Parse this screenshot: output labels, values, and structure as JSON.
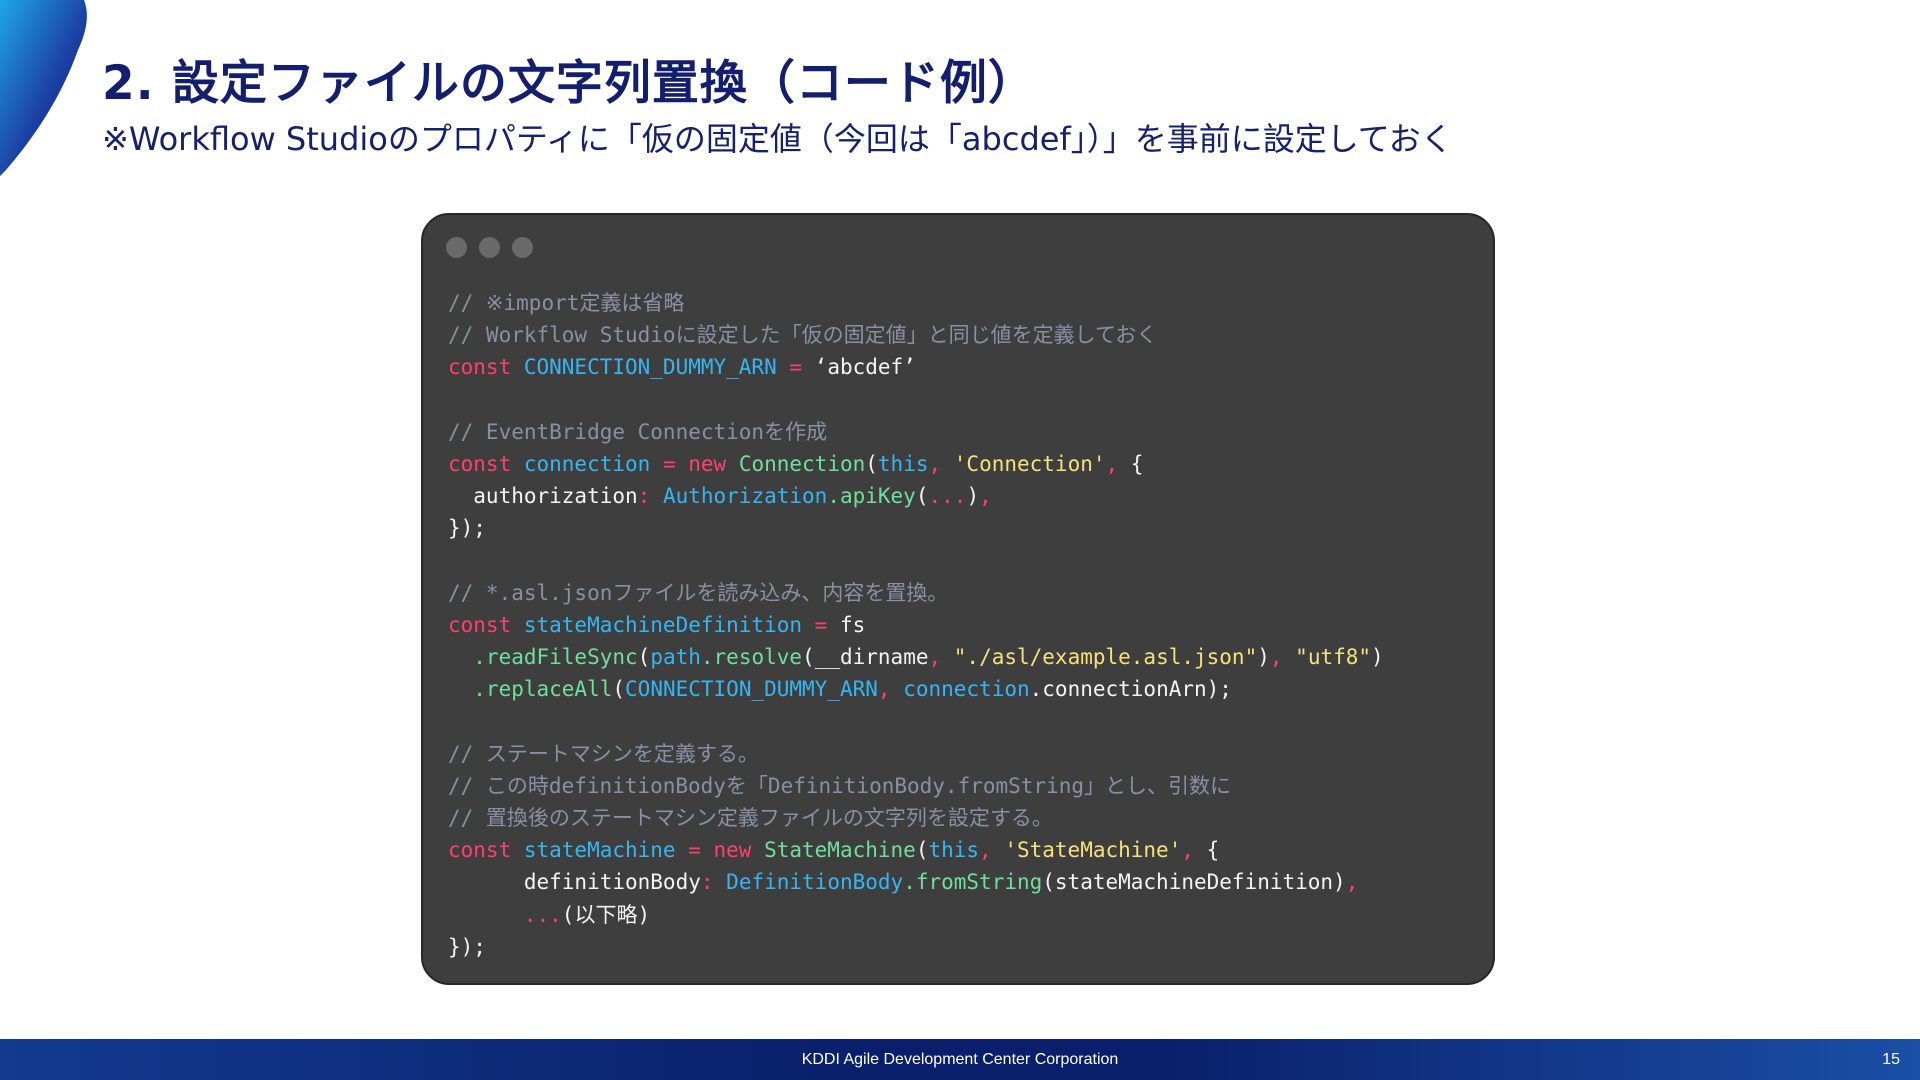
{
  "slide": {
    "title": "2. 設定ファイルの文字列置換（コード例）",
    "subtitle": "※Workflow Studioのプロパティに「仮の固定値（今回は「abcdef」）」を事前に設定しておく"
  },
  "code": {
    "lines": [
      [
        {
          "t": "c",
          "v": "// ※import定義は省略"
        }
      ],
      [
        {
          "t": "c",
          "v": "// Workflow Studioに設定した「仮の固定値」と同じ値を定義しておく"
        }
      ],
      [
        {
          "t": "k",
          "v": "const "
        },
        {
          "t": "v",
          "v": "CONNECTION_DUMMY_ARN"
        },
        {
          "t": "k",
          "v": " = "
        },
        {
          "t": "p",
          "v": "‘abcdef’"
        }
      ],
      [],
      [
        {
          "t": "c",
          "v": "// EventBridge Connectionを作成"
        }
      ],
      [
        {
          "t": "k",
          "v": "const "
        },
        {
          "t": "v",
          "v": "connection"
        },
        {
          "t": "k",
          "v": " = new "
        },
        {
          "t": "f",
          "v": "Connection"
        },
        {
          "t": "p",
          "v": "("
        },
        {
          "t": "v",
          "v": "this"
        },
        {
          "t": "k",
          "v": ", "
        },
        {
          "t": "s",
          "v": "'Connection'"
        },
        {
          "t": "k",
          "v": ", "
        },
        {
          "t": "p",
          "v": "{"
        }
      ],
      [
        {
          "t": "p",
          "v": "  authorization"
        },
        {
          "t": "k",
          "v": ": "
        },
        {
          "t": "v",
          "v": "Authorization"
        },
        {
          "t": "f",
          "v": ".apiKey"
        },
        {
          "t": "p",
          "v": "("
        },
        {
          "t": "k",
          "v": "..."
        },
        {
          "t": "p",
          "v": ")"
        },
        {
          "t": "k",
          "v": ","
        }
      ],
      [
        {
          "t": "p",
          "v": "});"
        }
      ],
      [],
      [
        {
          "t": "c",
          "v": "// *.asl.jsonファイルを読み込み、内容を置換。"
        }
      ],
      [
        {
          "t": "k",
          "v": "const "
        },
        {
          "t": "v",
          "v": "stateMachineDefinition"
        },
        {
          "t": "k",
          "v": " = "
        },
        {
          "t": "p",
          "v": "fs"
        }
      ],
      [
        {
          "t": "f",
          "v": "  .readFileSync"
        },
        {
          "t": "p",
          "v": "("
        },
        {
          "t": "v",
          "v": "path"
        },
        {
          "t": "f",
          "v": ".resolve"
        },
        {
          "t": "p",
          "v": "(__dirname"
        },
        {
          "t": "k",
          "v": ", "
        },
        {
          "t": "s",
          "v": "\"./asl/example.asl.json\""
        },
        {
          "t": "p",
          "v": ")"
        },
        {
          "t": "k",
          "v": ", "
        },
        {
          "t": "s",
          "v": "\"utf8\""
        },
        {
          "t": "p",
          "v": ")"
        }
      ],
      [
        {
          "t": "f",
          "v": "  .replaceAll"
        },
        {
          "t": "p",
          "v": "("
        },
        {
          "t": "v",
          "v": "CONNECTION_DUMMY_ARN"
        },
        {
          "t": "k",
          "v": ", "
        },
        {
          "t": "v",
          "v": "connection"
        },
        {
          "t": "p",
          "v": ".connectionArn);"
        }
      ],
      [],
      [
        {
          "t": "c",
          "v": "// ステートマシンを定義する。"
        }
      ],
      [
        {
          "t": "c",
          "v": "// この時definitionBodyを「DefinitionBody.fromString」とし、引数に"
        }
      ],
      [
        {
          "t": "c",
          "v": "// 置換後のステートマシン定義ファイルの文字列を設定する。"
        }
      ],
      [
        {
          "t": "k",
          "v": "const "
        },
        {
          "t": "v",
          "v": "stateMachine"
        },
        {
          "t": "k",
          "v": " = new "
        },
        {
          "t": "f",
          "v": "StateMachine"
        },
        {
          "t": "p",
          "v": "("
        },
        {
          "t": "v",
          "v": "this"
        },
        {
          "t": "k",
          "v": ", "
        },
        {
          "t": "s",
          "v": "'StateMachine'"
        },
        {
          "t": "k",
          "v": ", "
        },
        {
          "t": "p",
          "v": "{"
        }
      ],
      [
        {
          "t": "p",
          "v": "      definitionBody"
        },
        {
          "t": "k",
          "v": ": "
        },
        {
          "t": "v",
          "v": "DefinitionBody"
        },
        {
          "t": "f",
          "v": ".fromString"
        },
        {
          "t": "p",
          "v": "(stateMachineDefinition)"
        },
        {
          "t": "k",
          "v": ","
        }
      ],
      [
        {
          "t": "k",
          "v": "      ..."
        },
        {
          "t": "p",
          "v": "(以下略)"
        }
      ],
      [
        {
          "t": "p",
          "v": "});"
        }
      ]
    ]
  },
  "footer": {
    "company": "KDDI Agile Development Center Corporation",
    "page_number": "15"
  },
  "colors": {
    "title": "#141e6e",
    "code_background": "#3e3e3e",
    "comment": "#8a8fa6",
    "keyword": "#ff3d7a",
    "identifier": "#35b6f2",
    "function": "#6fe09a",
    "string": "#f6e27a",
    "footer": "#0a1f6b"
  }
}
